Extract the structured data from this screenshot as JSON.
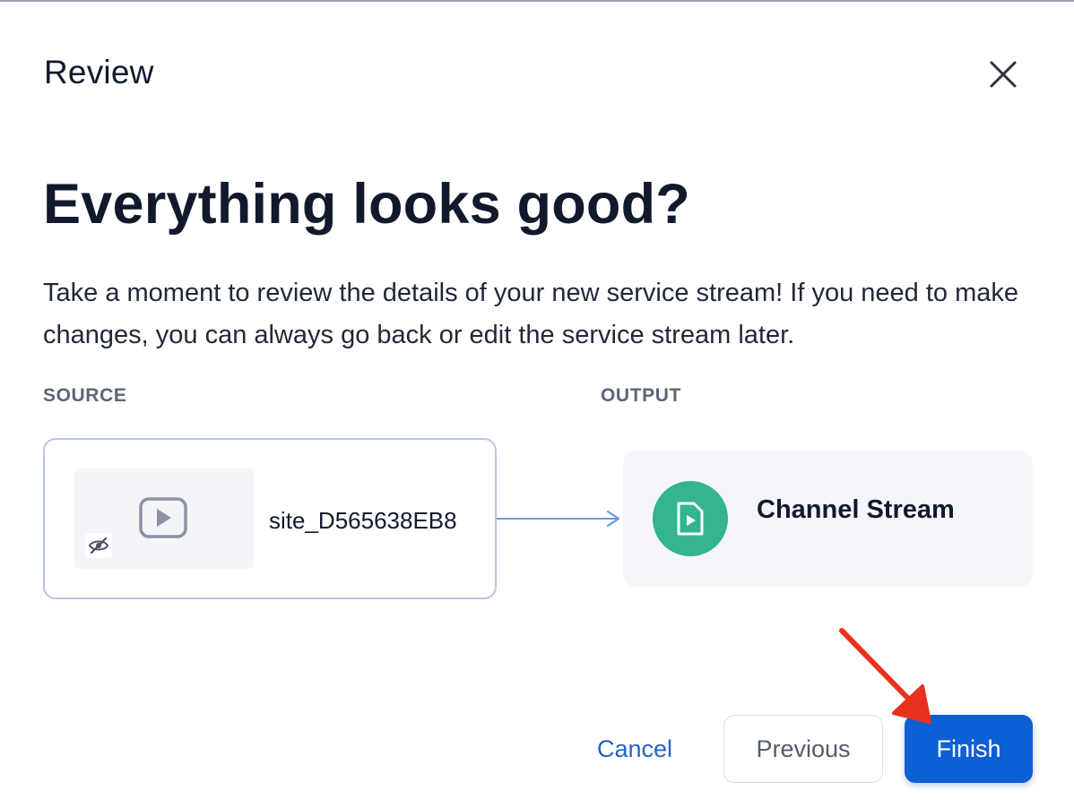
{
  "dialog": {
    "title": "Review",
    "close_icon": "close-icon"
  },
  "main": {
    "heading": "Everything looks good?",
    "description": "Take a moment to review the details of your new service stream! If you need to make changes, you can always go back or edit the service stream later."
  },
  "source": {
    "label": "SOURCE",
    "name": "site_D565638EB8",
    "thumbnail_icon": "play-video-icon",
    "visibility_icon": "eye-slash-icon"
  },
  "output": {
    "label": "OUTPUT",
    "name": "Channel Stream",
    "icon": "video-file-icon",
    "icon_color": "#34b48f"
  },
  "footer": {
    "cancel_label": "Cancel",
    "previous_label": "Previous",
    "finish_label": "Finish"
  },
  "colors": {
    "primary": "#0d5fd6",
    "link": "#2463c4",
    "annotation": "#e8321e"
  }
}
